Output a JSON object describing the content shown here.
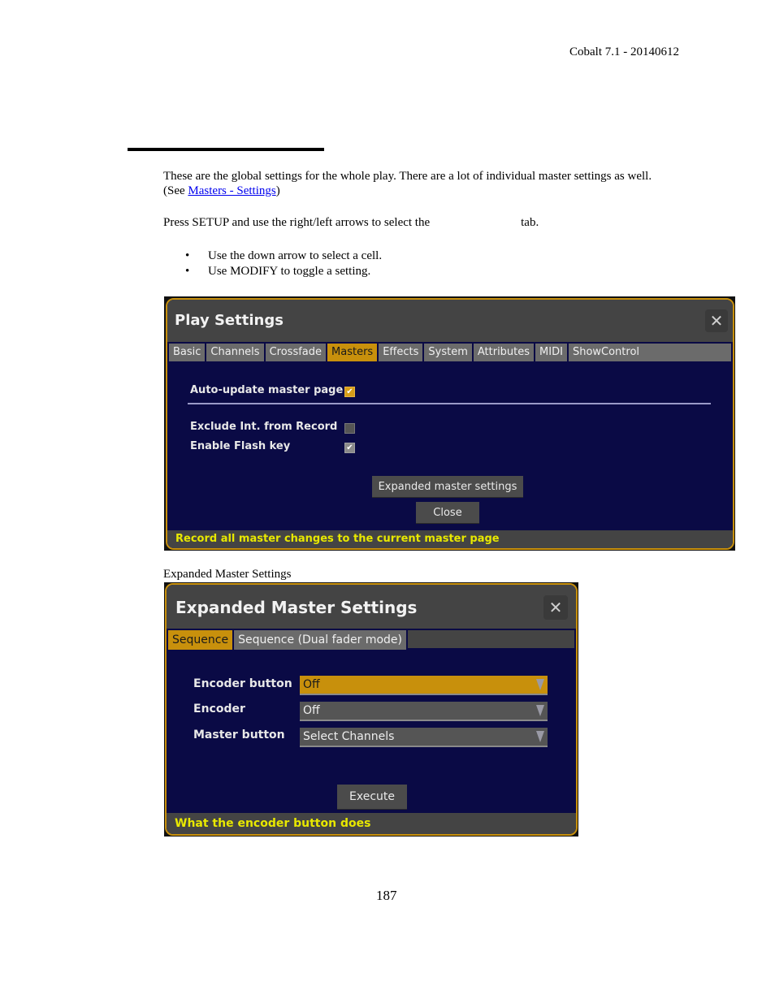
{
  "header": {
    "version": "Cobalt 7.1 - 20140612"
  },
  "intro": {
    "line1": "These are the global settings for the whole play. There are a lot of individual master settings as well.",
    "line2_prefix": "(See ",
    "link": "Masters - Settings",
    "line2_suffix": ")",
    "instruction_prefix": "Press SETUP and use the right/left arrows to select the",
    "instruction_suffix": "tab."
  },
  "bullets": [
    "Use the down arrow to select a cell.",
    "Use MODIFY to toggle a setting."
  ],
  "play_settings": {
    "title": "Play Settings",
    "close_icon": "close-icon",
    "tabs": [
      {
        "label": "Basic",
        "active": false
      },
      {
        "label": "Channels",
        "active": false
      },
      {
        "label": "Crossfade",
        "active": false
      },
      {
        "label": "Masters",
        "active": true
      },
      {
        "label": "Effects",
        "active": false
      },
      {
        "label": "System",
        "active": false
      },
      {
        "label": "Attributes",
        "active": false
      },
      {
        "label": "MIDI",
        "active": false
      },
      {
        "label": "ShowControl",
        "active": false
      }
    ],
    "options": [
      {
        "label": "Auto-update master page",
        "checked": true,
        "focused": true
      },
      {
        "label": "Exclude Int. from Record",
        "checked": false,
        "focused": false
      },
      {
        "label": "Enable Flash key",
        "checked": true,
        "focused": false
      }
    ],
    "expanded_button": "Expanded master settings",
    "close_button": "Close",
    "status": "Record all master changes to the current master page"
  },
  "caption": "Expanded Master Settings",
  "expanded_settings": {
    "title": "Expanded Master Settings",
    "close_icon": "close-icon",
    "tabs": [
      {
        "label": "Sequence",
        "active": true
      },
      {
        "label": "Sequence (Dual fader mode)",
        "active": false
      }
    ],
    "fields": [
      {
        "label": "Encoder button",
        "value": "Off",
        "focused": true
      },
      {
        "label": "Encoder",
        "value": "Off",
        "focused": false
      },
      {
        "label": "Master button",
        "value": "Select Channels",
        "focused": false
      }
    ],
    "execute_button": "Execute",
    "status": "What the encoder button does"
  },
  "footer": {
    "page_number": "187"
  },
  "colors": {
    "accent": "#c8900c",
    "panel": "#0a0a45",
    "titlebar": "#444444",
    "status_text": "#e8e800",
    "link": "#0000ee"
  }
}
